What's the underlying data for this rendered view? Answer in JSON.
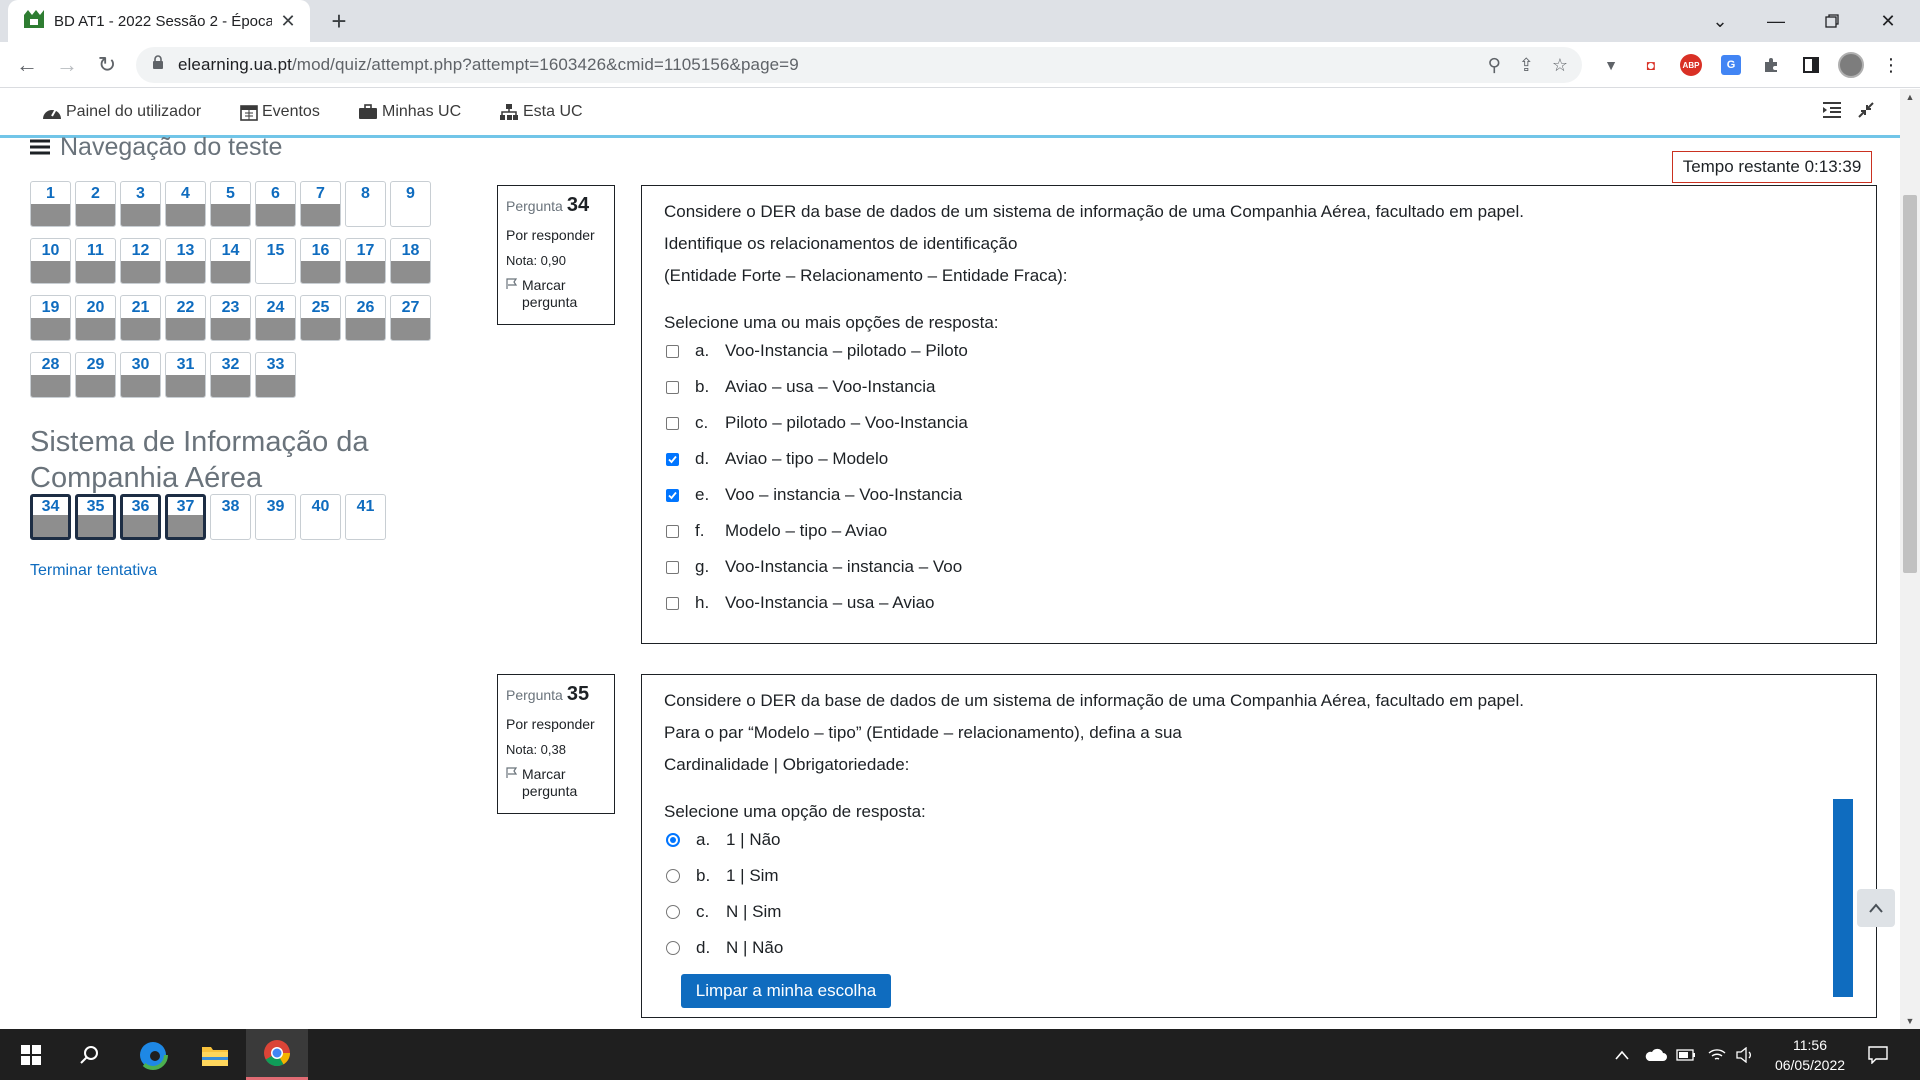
{
  "browser": {
    "tab_title": "BD AT1 - 2022 Sessão 2 - Época",
    "url_host": "elearning.ua.pt",
    "url_path": "/mod/quiz/attempt.php?attempt=1603426&cmid=1105156&page=9",
    "extensions": [
      "ABP"
    ]
  },
  "sitenav": {
    "dashboard": "Painel do utilizador",
    "events": "Eventos",
    "my_courses": "Minhas UC",
    "this_course": "Esta UC"
  },
  "quiz_nav": {
    "title": "Navegação do teste",
    "buttons": [
      {
        "n": "1",
        "state": "answered"
      },
      {
        "n": "2",
        "state": "answered"
      },
      {
        "n": "3",
        "state": "answered"
      },
      {
        "n": "4",
        "state": "answered"
      },
      {
        "n": "5",
        "state": "answered"
      },
      {
        "n": "6",
        "state": "answered"
      },
      {
        "n": "7",
        "state": "answered"
      },
      {
        "n": "8",
        "state": "unanswered"
      },
      {
        "n": "9",
        "state": "unanswered"
      },
      {
        "n": "10",
        "state": "answered"
      },
      {
        "n": "11",
        "state": "answered"
      },
      {
        "n": "12",
        "state": "answered"
      },
      {
        "n": "13",
        "state": "answered"
      },
      {
        "n": "14",
        "state": "answered"
      },
      {
        "n": "15",
        "state": "unanswered"
      },
      {
        "n": "16",
        "state": "answered"
      },
      {
        "n": "17",
        "state": "answered"
      },
      {
        "n": "18",
        "state": "answered"
      },
      {
        "n": "19",
        "state": "answered"
      },
      {
        "n": "20",
        "state": "answered"
      },
      {
        "n": "21",
        "state": "answered"
      },
      {
        "n": "22",
        "state": "answered"
      },
      {
        "n": "23",
        "state": "answered"
      },
      {
        "n": "24",
        "state": "answered"
      },
      {
        "n": "25",
        "state": "answered"
      },
      {
        "n": "26",
        "state": "answered"
      },
      {
        "n": "27",
        "state": "answered"
      },
      {
        "n": "28",
        "state": "answered"
      },
      {
        "n": "29",
        "state": "answered"
      },
      {
        "n": "30",
        "state": "answered"
      },
      {
        "n": "31",
        "state": "answered"
      },
      {
        "n": "32",
        "state": "answered"
      },
      {
        "n": "33",
        "state": "answered"
      }
    ],
    "section_title": "Sistema de Informação da Companhia Aérea",
    "section_buttons": [
      {
        "n": "34",
        "state": "current"
      },
      {
        "n": "35",
        "state": "current"
      },
      {
        "n": "36",
        "state": "current"
      },
      {
        "n": "37",
        "state": "current"
      },
      {
        "n": "38",
        "state": "unanswered"
      },
      {
        "n": "39",
        "state": "unanswered"
      },
      {
        "n": "40",
        "state": "unanswered"
      },
      {
        "n": "41",
        "state": "unanswered"
      }
    ],
    "finish_link": "Terminar tentativa"
  },
  "timer": "Tempo restante 0:13:39",
  "questions": [
    {
      "label": "Pergunta",
      "number": "34",
      "state": "Por responder",
      "grade": "Nota: 0,90",
      "flag": "Marcar pergunta",
      "text": [
        "Considere o DER da base de dados de um sistema de informação de uma Companhia Aérea, facultado em papel.",
        "Identifique os relacionamentos de identificação",
        "(Entidade Forte – Relacionamento – Entidade Fraca):"
      ],
      "prompt": "Selecione uma ou mais opções de resposta:",
      "options": [
        {
          "letter": "a.",
          "text": "Voo-Instancia – pilotado – Piloto",
          "checked": false
        },
        {
          "letter": "b.",
          "text": "Aviao – usa – Voo-Instancia",
          "checked": false
        },
        {
          "letter": "c.",
          "text": "Piloto – pilotado – Voo-Instancia",
          "checked": false
        },
        {
          "letter": "d.",
          "text": "Aviao – tipo – Modelo",
          "checked": true
        },
        {
          "letter": "e.",
          "text": "Voo – instancia – Voo-Instancia",
          "checked": true
        },
        {
          "letter": "f.",
          "text": "Modelo – tipo – Aviao",
          "checked": false
        },
        {
          "letter": "g.",
          "text": "Voo-Instancia – instancia – Voo",
          "checked": false
        },
        {
          "letter": "h.",
          "text": "Voo-Instancia – usa – Aviao",
          "checked": false
        }
      ]
    },
    {
      "label": "Pergunta",
      "number": "35",
      "state": "Por responder",
      "grade": "Nota: 0,38",
      "flag": "Marcar pergunta",
      "text": [
        "Considere o DER da base de dados de um sistema de informação de uma Companhia Aérea, facultado em papel.",
        "Para o par “Modelo – tipo” (Entidade – relacionamento), defina a sua",
        "Cardinalidade | Obrigatoriedade:"
      ],
      "prompt": "Selecione uma opção de resposta:",
      "options": [
        {
          "letter": "a.",
          "text": "1 | Não",
          "checked": true
        },
        {
          "letter": "b.",
          "text": "1 | Sim",
          "checked": false
        },
        {
          "letter": "c.",
          "text": "N | Sim",
          "checked": false
        },
        {
          "letter": "d.",
          "text": "N | Não",
          "checked": false
        }
      ],
      "clear_button": "Limpar a minha escolha"
    }
  ],
  "taskbar": {
    "time": "11:56",
    "date": "06/05/2022"
  },
  "colors": {
    "moodle_blue": "#0f6cbf",
    "nav_accent": "#71c5e8",
    "timer_border": "#ca3120",
    "answered_fill": "#8e8e8e",
    "taskbar": "#1f1f1f"
  }
}
